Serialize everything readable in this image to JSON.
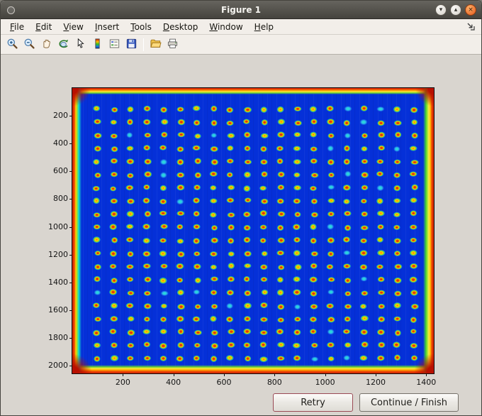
{
  "window": {
    "title": "Figure 1",
    "controls": {
      "minimize_glyph": "▾",
      "maximize_glyph": "▴",
      "close_glyph": "×"
    }
  },
  "menu_bar": {
    "items": [
      {
        "label": "File"
      },
      {
        "label": "Edit"
      },
      {
        "label": "View"
      },
      {
        "label": "Insert"
      },
      {
        "label": "Tools"
      },
      {
        "label": "Desktop"
      },
      {
        "label": "Window"
      },
      {
        "label": "Help"
      }
    ],
    "dock_icon": "dock-figure-icon"
  },
  "toolbar": {
    "icons": [
      "zoom-in-icon",
      "zoom-out-icon",
      "pan-hand-icon",
      "rotate-3d-icon",
      "data-cursor-icon",
      "colorbar-icon",
      "legend-icon",
      "save-icon",
      "open-folder-icon",
      "print-icon"
    ]
  },
  "chart_data": {
    "type": "heatmap",
    "colormap": "jet",
    "title": "",
    "xlabel": "",
    "ylabel": "",
    "x_ticks": [
      200,
      400,
      600,
      800,
      1000,
      1200,
      1400
    ],
    "y_ticks": [
      200,
      400,
      600,
      800,
      1000,
      1200,
      1400,
      1600,
      1800,
      2000
    ],
    "x_range": [
      0,
      1430
    ],
    "y_range": [
      0,
      2055
    ],
    "spots": {
      "rows": 20,
      "cols": 20,
      "x_start": 98,
      "x_step": 66,
      "y_start": 152,
      "y_step": 94.5
    },
    "description": "Microarray plate scan image: regular 20x20 grid of hot (red core / yellow-green halo) spots on deep blue background, saturated red-orange edges with cyan band on left and green band on right"
  },
  "action_buttons": {
    "retry_label": "Retry",
    "continue_label": "Continue / Finish"
  },
  "colors": {
    "plot_background": "#0530d8",
    "figure_background": "#d9d5cf",
    "chrome_background": "#f2eee9",
    "titlebar_gradient_top": "#66645e",
    "titlebar_gradient_bottom": "#45433e",
    "close_button": "#e2571c",
    "spot_core": "#d8240a",
    "spot_ring": "#ffd400",
    "edge_red": "#c81c02"
  }
}
